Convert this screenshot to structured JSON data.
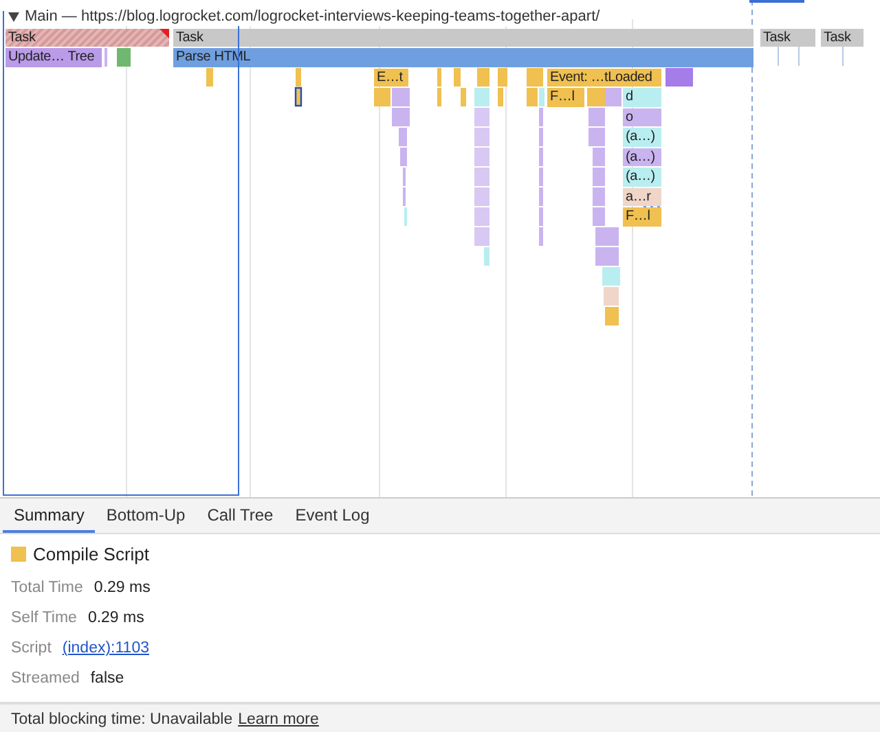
{
  "timeline": {
    "track_title": "Main — https://blog.logrocket.com/logrocket-interviews-keeping-teams-together-apart/",
    "blocks": [
      {
        "label": "Task",
        "color": "#e4b5b5",
        "long": true
      },
      {
        "label": "Task",
        "color": "#c8c8c8",
        "long": false
      },
      {
        "label": "Task",
        "color": "#c8c8c8",
        "long": false
      },
      {
        "label": "Task",
        "color": "#c8c8c8",
        "long": false
      },
      {
        "label": "Update… Tree",
        "color": "#b99be8",
        "long": false
      },
      {
        "label": "Parse HTML",
        "color": "#6f9fe0",
        "long": false
      },
      {
        "label": "E…t",
        "color": "#f0c050",
        "long": false
      },
      {
        "label": "Event: …tLoaded",
        "color": "#f0c050",
        "long": false
      },
      {
        "label": "F…l",
        "color": "#f0c050",
        "long": false
      },
      {
        "label": "d",
        "color": "#b9eef0",
        "long": false
      },
      {
        "label": "o",
        "color": "#c9b4f0",
        "long": false
      },
      {
        "label": "(a…)",
        "color": "#b9eef0",
        "long": false
      },
      {
        "label": "(a…)",
        "color": "#c9b4f0",
        "long": false
      },
      {
        "label": "(a…)",
        "color": "#b9eef0",
        "long": false
      },
      {
        "label": "a…r",
        "color": "#f0d6c8",
        "long": false
      },
      {
        "label": "F…l",
        "color": "#f0c050",
        "long": false
      }
    ]
  },
  "tabs": [
    {
      "label": "Summary",
      "selected": true
    },
    {
      "label": "Bottom-Up",
      "selected": false
    },
    {
      "label": "Call Tree",
      "selected": false
    },
    {
      "label": "Event Log",
      "selected": false
    }
  ],
  "summary": {
    "title": "Compile Script",
    "color": "#f0c050",
    "rows": [
      {
        "kind": "text",
        "label": "Total Time",
        "value": "0.29 ms"
      },
      {
        "kind": "text",
        "label": "Self Time",
        "value": "0.29 ms"
      },
      {
        "kind": "link",
        "label": "Script",
        "value": "(index):1103"
      },
      {
        "kind": "text",
        "label": "Streamed",
        "value": "false"
      }
    ]
  },
  "status_bar": {
    "text": "Total blocking time: Unavailable",
    "link": "Learn more"
  }
}
